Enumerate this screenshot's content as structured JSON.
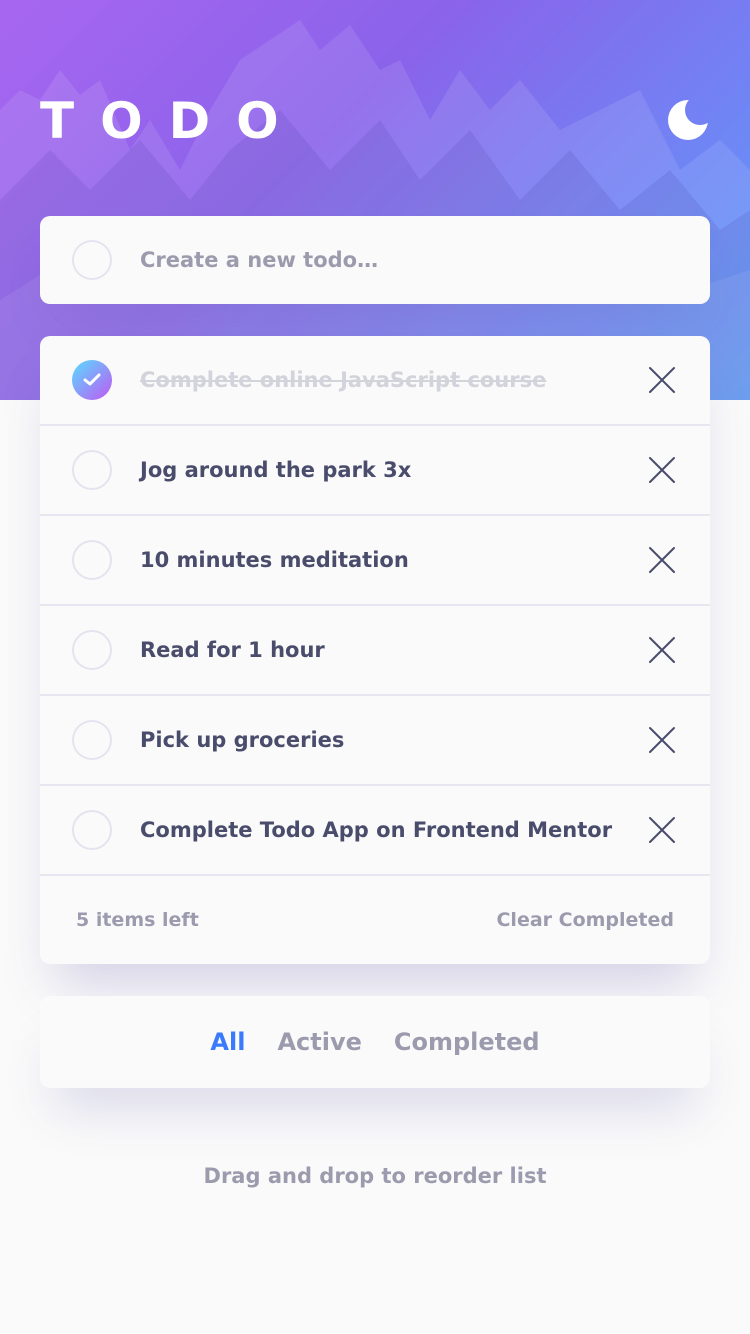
{
  "app": {
    "title": "TODO",
    "theme_icon": "moon-icon"
  },
  "new_todo": {
    "placeholder": "Create a new todo…",
    "value": ""
  },
  "todos": [
    {
      "text": "Complete online JavaScript course",
      "completed": true
    },
    {
      "text": "Jog around the park 3x",
      "completed": false
    },
    {
      "text": "10 minutes meditation",
      "completed": false
    },
    {
      "text": "Read for 1 hour",
      "completed": false
    },
    {
      "text": "Pick up groceries",
      "completed": false
    },
    {
      "text": "Complete Todo App on Frontend Mentor",
      "completed": false
    }
  ],
  "footer": {
    "items_left": "5 items left",
    "clear_label": "Clear Completed"
  },
  "filters": {
    "all": "All",
    "active": "Active",
    "completed": "Completed",
    "selected": "all"
  },
  "hint": "Drag and drop to reorder list",
  "colors": {
    "accent": "#3a7bfd",
    "check_gradient_start": "#57ddff",
    "check_gradient_end": "#c058f3"
  },
  "icons": {
    "check": "check-icon",
    "delete": "cross-icon"
  }
}
